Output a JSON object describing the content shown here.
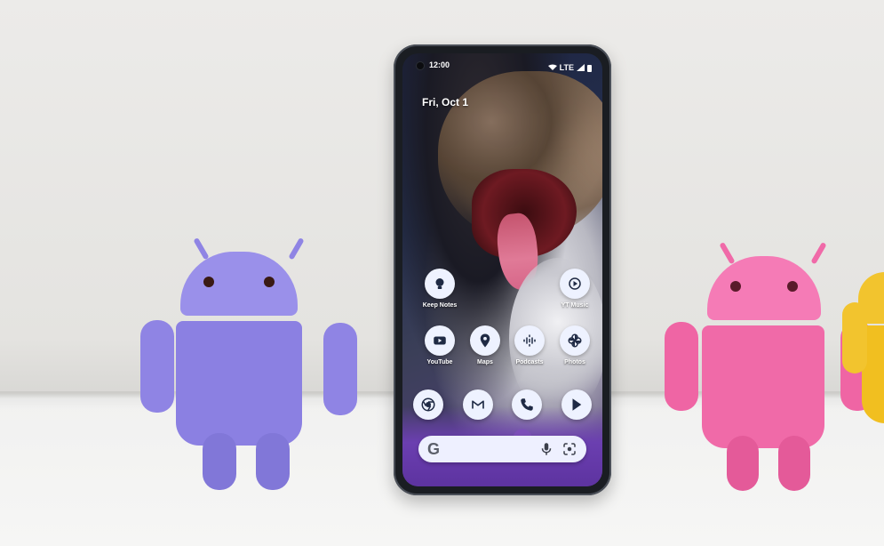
{
  "scene": {
    "left_figure_color": "#8f84e4",
    "right_figure_color": "#f06aa8",
    "partial_figure_color": "#f2c42e"
  },
  "phone": {
    "status_bar": {
      "time": "12:00",
      "network": "LTE"
    },
    "date": "Fri, Oct 1",
    "apps_row1": [
      {
        "label": "Keep Notes",
        "icon": "bulb-icon"
      },
      {
        "label": "YT Music",
        "icon": "music-play-icon"
      }
    ],
    "apps_row2": [
      {
        "label": "YouTube",
        "icon": "youtube-icon"
      },
      {
        "label": "Maps",
        "icon": "map-pin-icon"
      },
      {
        "label": "Podcasts",
        "icon": "podcasts-icon"
      },
      {
        "label": "Photos",
        "icon": "pinwheel-icon"
      }
    ],
    "dock": [
      {
        "icon": "chrome-icon"
      },
      {
        "icon": "gmail-icon"
      },
      {
        "icon": "phone-icon"
      },
      {
        "icon": "play-store-icon"
      }
    ],
    "search": {
      "logo": "G",
      "mic_icon": "mic-icon",
      "lens_icon": "lens-icon"
    }
  }
}
